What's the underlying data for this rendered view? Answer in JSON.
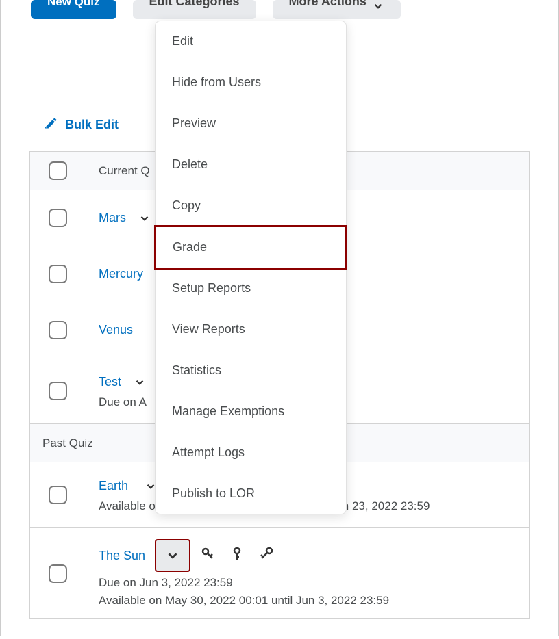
{
  "buttons": {
    "new_quiz": "New Quiz",
    "edit_categories": "Edit Categories",
    "more_actions": "More Actions"
  },
  "bulk_edit": "Bulk Edit",
  "table": {
    "header_current": "Current Q",
    "section_past": "Past Quiz",
    "rows": [
      {
        "title": "Mars"
      },
      {
        "title": "Mercury"
      },
      {
        "title": "Venus"
      },
      {
        "title": "Test",
        "due": "Due on A"
      },
      {
        "title": "Earth",
        "available": "Available on",
        "available_tail": "n 23, 2022 23:59"
      },
      {
        "title": "The Sun",
        "due": "Due on Jun 3, 2022 23:59",
        "available": "Available on May 30, 2022 00:01 until Jun 3, 2022 23:59"
      }
    ]
  },
  "dropdown": {
    "items": [
      "Edit",
      "Hide from Users",
      "Preview",
      "Delete",
      "Copy",
      "Grade",
      "Setup Reports",
      "View Reports",
      "Statistics",
      "Manage Exemptions",
      "Attempt Logs",
      "Publish to LOR"
    ],
    "highlighted_index": 5
  }
}
